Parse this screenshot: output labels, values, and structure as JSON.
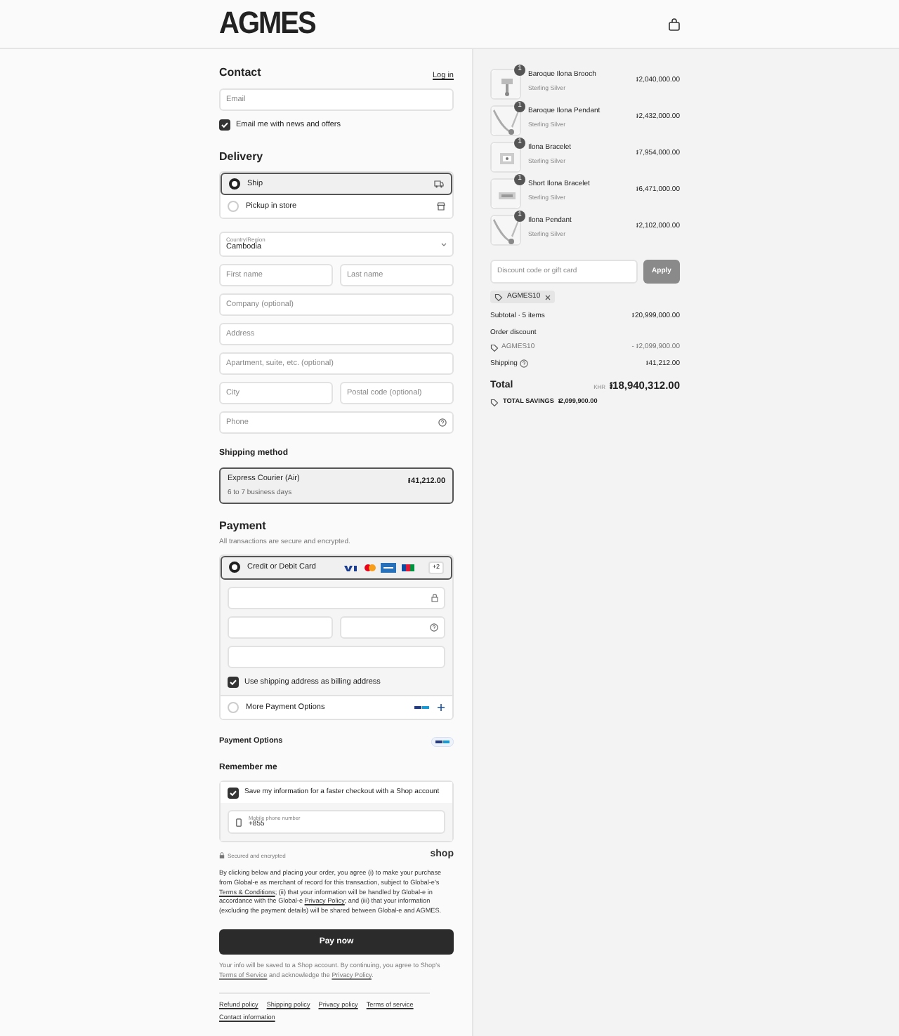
{
  "header": {
    "logo": "AGMES"
  },
  "contact": {
    "title": "Contact",
    "login": "Log in",
    "email_placeholder": "Email",
    "newsletter": {
      "label": "Email me with news and offers",
      "checked": true
    }
  },
  "delivery": {
    "title": "Delivery",
    "options": [
      {
        "label": "Ship",
        "selected": true,
        "kind": "ship"
      },
      {
        "label": "Pickup in store",
        "selected": false,
        "kind": "store"
      }
    ],
    "country": {
      "label": "Country/Region",
      "value": "Cambodia"
    },
    "rows": [
      [
        {
          "placeholder": "First name"
        },
        {
          "placeholder": "Last name"
        }
      ],
      [
        {
          "placeholder": "Company (optional)"
        }
      ],
      [
        {
          "placeholder": "Address"
        }
      ],
      [
        {
          "placeholder": "Apartment, suite, etc. (optional)"
        }
      ],
      [
        {
          "placeholder": "City"
        },
        {
          "placeholder": "Postal code (optional)"
        }
      ],
      [
        {
          "placeholder": "Phone",
          "help": true
        }
      ]
    ]
  },
  "shipping_method": {
    "title": "Shipping method",
    "option": {
      "name": "Express Courier (Air)",
      "detail": "6 to 7 business days",
      "price": "៛41,212.00",
      "selected": true
    }
  },
  "payment": {
    "title": "Payment",
    "subtitle": "All transactions are secure and encrypted.",
    "card": {
      "label": "Credit or Debit Card",
      "selected": true,
      "more_brands": "+2",
      "billing": {
        "label": "Use shipping address as billing address",
        "checked": true
      }
    },
    "more": {
      "label": "More Payment Options",
      "selected": false
    }
  },
  "payment_options": {
    "title": "Payment Options"
  },
  "remember": {
    "title": "Remember me",
    "save": {
      "label": "Save my information for a faster checkout with a Shop account",
      "checked": true
    },
    "phone": {
      "label": "Mobile phone number",
      "value": "+855"
    }
  },
  "secure": {
    "text": "Secured and encrypted",
    "brand": "shop"
  },
  "legal": [
    {
      "text": "By clicking below and placing your order, you agree (i) to make your purchase from Global-e as merchant of record for this transaction, subject to Global-e's "
    },
    {
      "text": "Terms & Conditions",
      "link": true
    },
    {
      "text": "; (ii) that your information will be handled by Global-e in accordance with the Global-e "
    },
    {
      "text": "Privacy Policy",
      "link": true
    },
    {
      "text": "; and (iii) that your information (excluding the payment details) will be shared between Global-e and AGMES."
    }
  ],
  "pay_button": "Pay now",
  "shop_note": [
    {
      "text": "Your info will be saved to a Shop account. By continuing, you agree to Shop's "
    },
    {
      "text": "Terms of Service",
      "link": true
    },
    {
      "text": " and acknowledge the "
    },
    {
      "text": "Privacy Policy",
      "link": true
    },
    {
      "text": "."
    }
  ],
  "footer_links": [
    "Refund policy",
    "Shipping policy",
    "Privacy policy",
    "Terms of service",
    "Contact information"
  ],
  "summary": {
    "items": [
      {
        "name": "Baroque Ilona Brooch",
        "variant": "Sterling Silver",
        "price": "៛2,040,000.00",
        "quantity": "1"
      },
      {
        "name": "Baroque Ilona Pendant",
        "variant": "Sterling Silver",
        "price": "៛2,432,000.00",
        "quantity": "1"
      },
      {
        "name": "Ilona Bracelet",
        "variant": "Sterling Silver",
        "price": "៛7,954,000.00",
        "quantity": "1"
      },
      {
        "name": "Short Ilona Bracelet",
        "variant": "Sterling Silver",
        "price": "៛6,471,000.00",
        "quantity": "1"
      },
      {
        "name": "Ilona Pendant",
        "variant": "Sterling Silver",
        "price": "៛2,102,000.00",
        "quantity": "1"
      }
    ],
    "discount_placeholder": "Discount code or gift card",
    "apply": "Apply",
    "applied_code": "AGMES10",
    "subtotal": {
      "label": "Subtotal · 5 items",
      "value": "៛20,999,000.00"
    },
    "discount_title": "Order discount",
    "discount": {
      "label": "AGMES10",
      "value": "- ៛2,099,900.00"
    },
    "shipping": {
      "label": "Shipping",
      "value": "៛41,212.00"
    },
    "total": {
      "label": "Total",
      "currency": "KHR",
      "value": "៛18,940,312.00"
    },
    "savings": {
      "label": "TOTAL SAVINGS",
      "value": "៛2,099,900.00"
    }
  }
}
